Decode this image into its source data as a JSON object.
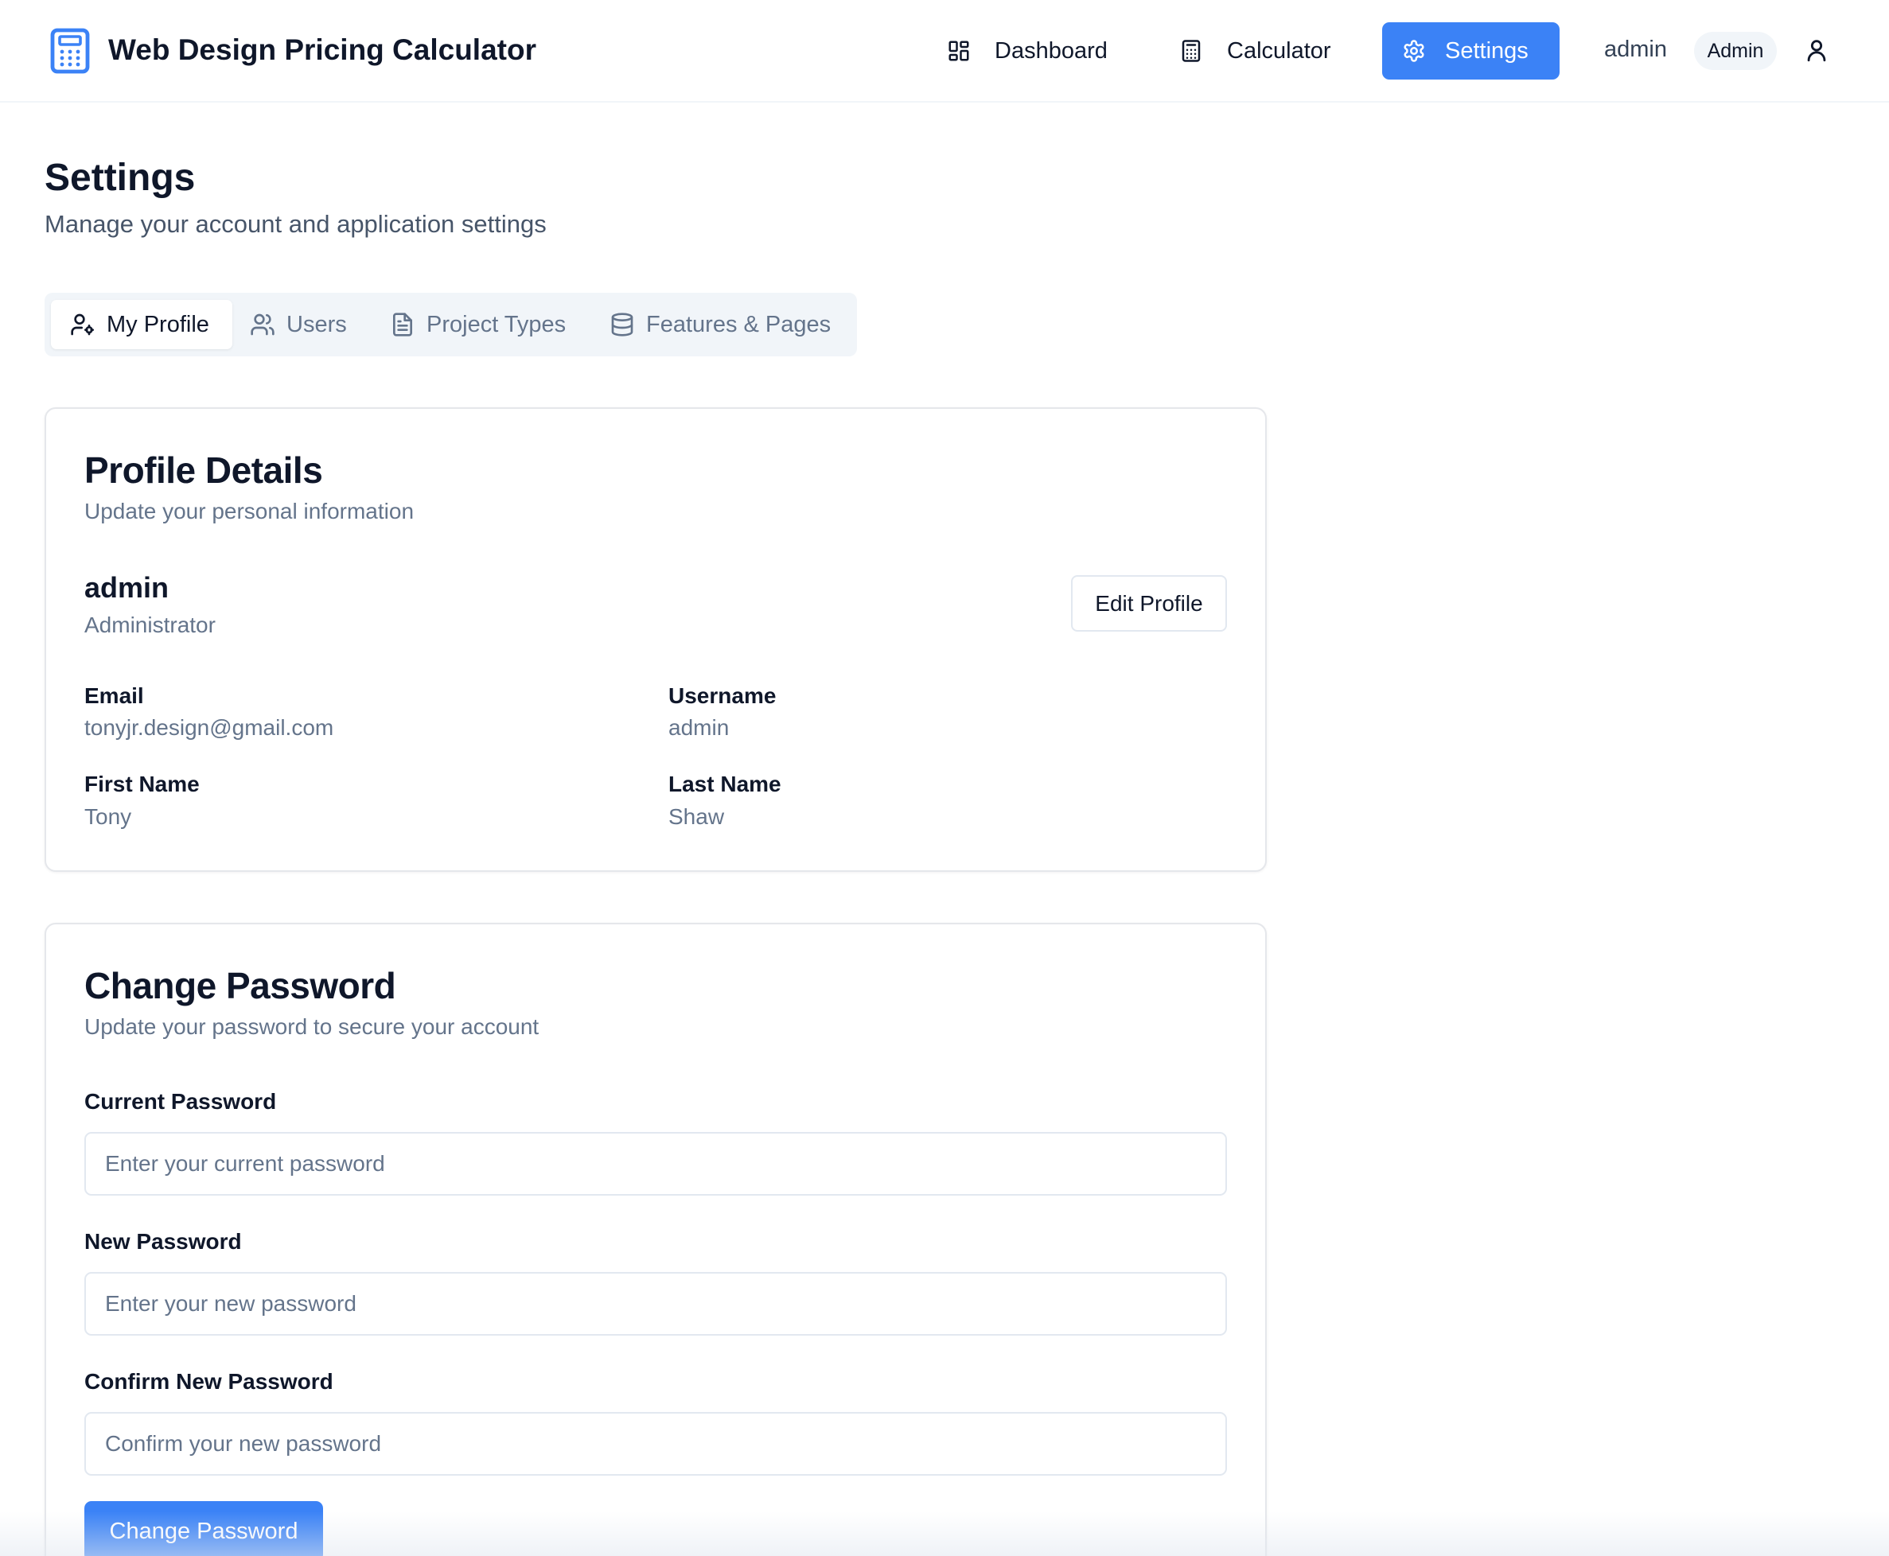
{
  "app": {
    "title": "Web Design Pricing Calculator"
  },
  "nav": {
    "items": [
      {
        "label": "Dashboard",
        "icon": "dashboard-grid-icon"
      },
      {
        "label": "Calculator",
        "icon": "calculator-icon"
      },
      {
        "label": "Settings",
        "icon": "gear-icon",
        "active": true
      }
    ],
    "user_name": "admin",
    "role_badge": "Admin"
  },
  "page": {
    "title": "Settings",
    "subtitle": "Manage your account and application settings"
  },
  "tabs": [
    {
      "label": "My Profile",
      "icon": "user-cog-icon",
      "active": true
    },
    {
      "label": "Users",
      "icon": "users-icon"
    },
    {
      "label": "Project Types",
      "icon": "file-text-icon"
    },
    {
      "label": "Features & Pages",
      "icon": "database-icon"
    }
  ],
  "profile": {
    "title": "Profile Details",
    "description": "Update your personal information",
    "name": "admin",
    "role": "Administrator",
    "edit_label": "Edit Profile",
    "fields": [
      {
        "label": "Email",
        "value": "tonyjr.design@gmail.com"
      },
      {
        "label": "Username",
        "value": "admin"
      },
      {
        "label": "First Name",
        "value": "Tony"
      },
      {
        "label": "Last Name",
        "value": "Shaw"
      }
    ]
  },
  "password": {
    "title": "Change Password",
    "description": "Update your password to secure your account",
    "fields": [
      {
        "label": "Current Password",
        "placeholder": "Enter your current password"
      },
      {
        "label": "New Password",
        "placeholder": "Enter your new password"
      },
      {
        "label": "Confirm New Password",
        "placeholder": "Confirm your new password"
      }
    ],
    "submit_label": "Change Password"
  },
  "colors": {
    "accent": "#3b82f6",
    "text_primary": "#0f172a",
    "text_muted": "#64748b",
    "border": "#e2e8f0",
    "tab_bg": "#f1f5f9"
  }
}
